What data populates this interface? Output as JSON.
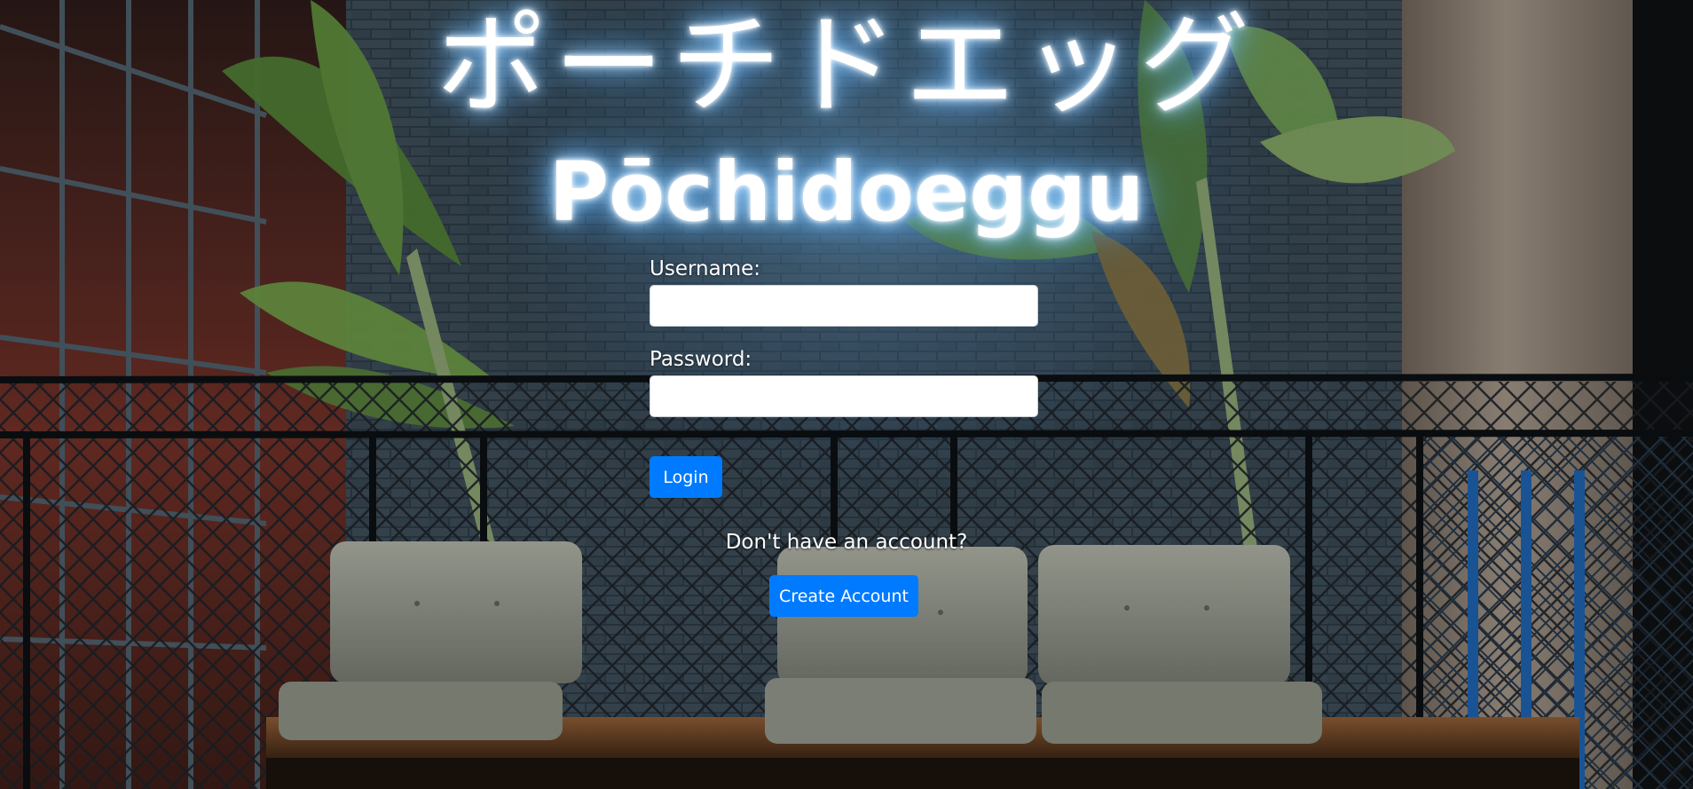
{
  "brand": {
    "title_japanese": "ポーチドエッグ",
    "title_romaji": "Pōchidoeggu",
    "neon_color": "#7cc2ff"
  },
  "login_form": {
    "username_label": "Username:",
    "username_value": "",
    "password_label": "Password:",
    "password_value": "",
    "login_button": "Login"
  },
  "signup": {
    "prompt": "Don't have an account?",
    "create_button": "Create Account"
  },
  "colors": {
    "primary_button": "#007bff",
    "text": "#ffffff"
  }
}
